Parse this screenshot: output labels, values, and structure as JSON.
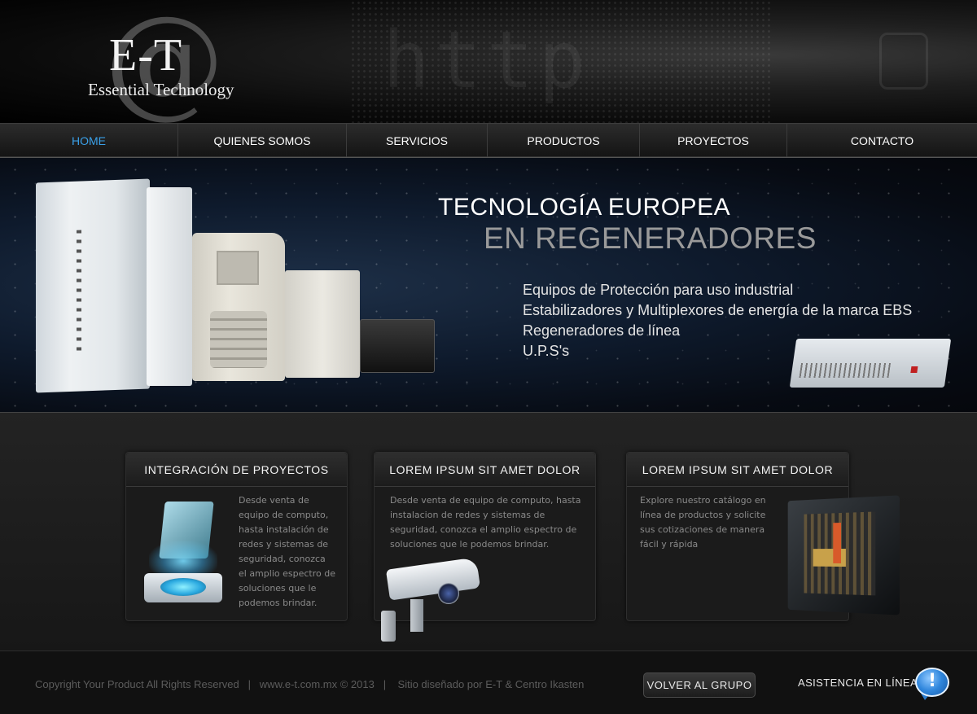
{
  "brand": {
    "logo_letters": "E-T",
    "logo_symbol": "@",
    "logo_name": "Essential Technology"
  },
  "nav": {
    "items": [
      {
        "label": "HOME",
        "active": true
      },
      {
        "label": "QUIENES SOMOS",
        "active": false
      },
      {
        "label": "SERVICIOS",
        "active": false
      },
      {
        "label": "PRODUCTOS",
        "active": false
      },
      {
        "label": "PROYECTOS",
        "active": false
      },
      {
        "label": "CONTACTO",
        "active": false
      }
    ],
    "active_color": "#3aa0e8"
  },
  "banner": {
    "title_line1": "TECNOLOGÍA EUROPEA",
    "title_line2": "EN REGENERADORES",
    "items": [
      "Equipos de Protección para uso industrial",
      "Estabilizadores y Multiplexores de energía de la marca EBS",
      "Regeneradores de línea",
      "U.P.S's"
    ]
  },
  "cards": [
    {
      "title": "INTEGRACIÓN DE PROYECTOS",
      "text": "Desde venta de equipo de computo, hasta instalación de redes y sistemas de seguridad, conozca el amplio espectro de soluciones que le podemos brindar.",
      "icon": "holographic-folder-icon"
    },
    {
      "title": "LOREM IPSUM SIT AMET DOLOR",
      "text": "Desde venta de equipo de computo, hasta instalacion de redes y sistemas de seguridad, conozca el amplio espectro de soluciones que le podemos brindar.",
      "icon": "security-camera-icon"
    },
    {
      "title": "LOREM IPSUM SIT AMET DOLOR",
      "text": "Explore nuestro catálogo en línea de productos y solicite sus cotizaciones de manera fácil y rápida",
      "icon": "circuit-board-icon"
    }
  ],
  "footer": {
    "copyright": "Copyright Your Product All Rights Reserved   |   www.e-t.com.mx © 2013   |    Sitio diseñado por E-T & Centro Ikasten",
    "back_button": "VOLVER AL GRUPO",
    "assistance": "ASISTENCIA EN LÍNEA",
    "help_mark": "!"
  }
}
